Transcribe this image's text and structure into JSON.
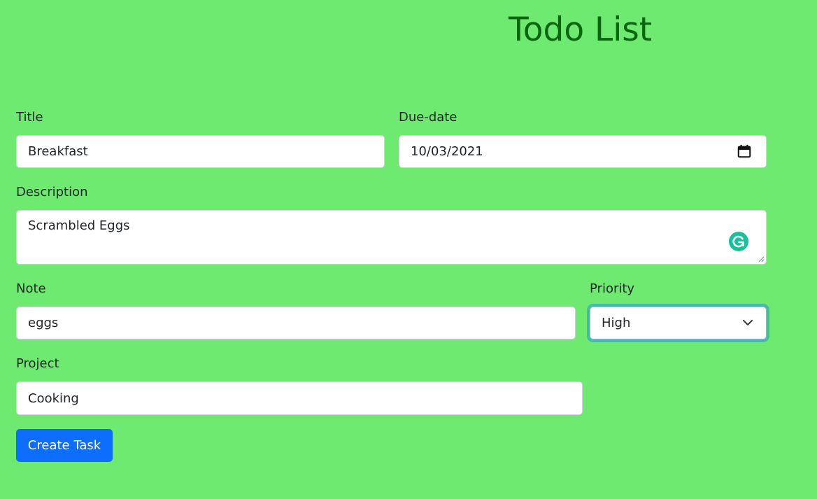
{
  "header": {
    "title": "Todo List"
  },
  "form": {
    "title": {
      "label": "Title",
      "value": "Breakfast"
    },
    "due_date": {
      "label": "Due-date",
      "value": "10/03/2021"
    },
    "description": {
      "label": "Description",
      "value": "Scrambled Eggs"
    },
    "note": {
      "label": "Note",
      "value": "eggs"
    },
    "priority": {
      "label": "Priority",
      "value": "High"
    },
    "project": {
      "label": "Project",
      "value": "Cooking"
    },
    "submit_label": "Create Task"
  },
  "icons": {
    "calendar": "calendar-icon",
    "grammarly": "grammarly-icon",
    "dropdown": "chevron-down-icon",
    "resize": "resize-handle-icon"
  },
  "colors": {
    "background": "#6dea6f",
    "title": "#0b640f",
    "button": "#0d6efd",
    "grammarly": "#15c39a",
    "focus_ring": "#32a5b4"
  }
}
